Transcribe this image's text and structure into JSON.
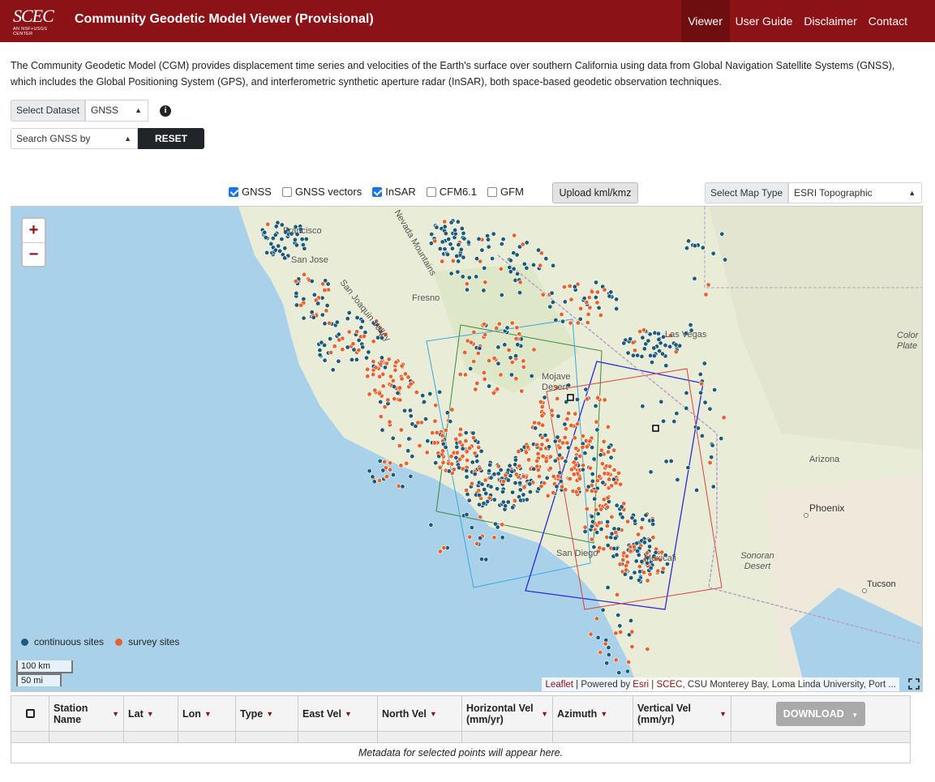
{
  "header": {
    "logo_text": "SCEC",
    "logo_subtext": "AN NSF+USGS CENTER",
    "title": "Community Geodetic Model Viewer (Provisional)",
    "nav": [
      {
        "label": "Viewer",
        "active": true
      },
      {
        "label": "User Guide",
        "active": false
      },
      {
        "label": "Disclaimer",
        "active": false
      },
      {
        "label": "Contact",
        "active": false
      }
    ]
  },
  "intro": "The Community Geodetic Model (CGM) provides displacement time series and velocities of the Earth's surface over southern California using data from Global Navigation Satellite Systems (GNSS), which includes the Global Positioning System (GPS), and interferometric synthetic aperture radar (InSAR), both space-based geodetic observation techniques.",
  "controls": {
    "dataset_label": "Select Dataset",
    "dataset_value": "GNSS",
    "search_value": "Search GNSS by",
    "reset_label": "RESET"
  },
  "layers": [
    {
      "label": "GNSS",
      "checked": true
    },
    {
      "label": "GNSS vectors",
      "checked": false
    },
    {
      "label": "InSAR",
      "checked": true
    },
    {
      "label": "CFM6.1",
      "checked": false
    },
    {
      "label": "GFM",
      "checked": false
    }
  ],
  "upload_label": "Upload kml/kmz",
  "map_type": {
    "label": "Select Map Type",
    "value": "ESRI Topographic"
  },
  "map": {
    "zoom_in": "+",
    "zoom_out": "−",
    "place_labels": [
      "Francisco",
      "San Jose",
      "Fresno",
      "San Joaquin Valley",
      "Nevada Mountains",
      "Las Vegas",
      "Mojave Desert",
      "San Diego",
      "Mexicali",
      "Arizona",
      "Phoenix",
      "Sonoran Desert",
      "Tucson",
      "Color Plate"
    ],
    "legend": [
      {
        "label": "continuous sites",
        "color": "#1d5c78"
      },
      {
        "label": "survey sites",
        "color": "#e8622c"
      }
    ],
    "scale_km": "100 km",
    "scale_mi": "50 mi",
    "attribution": {
      "leaflet": "Leaflet",
      "sep1": " | Powered by ",
      "esri": "Esri",
      "sep2": " | ",
      "scec": "SCEC",
      "rest": ", CSU Monterey Bay, Loma Linda University, Port ..."
    }
  },
  "table": {
    "columns": [
      "Station Name",
      "Lat",
      "Lon",
      "Type",
      "East Vel",
      "North Vel",
      "Horizontal Vel (mm/yr)",
      "Azimuth",
      "Vertical Vel (mm/yr)"
    ],
    "download_label": "DOWNLOAD",
    "empty_message": "Metadata for selected points will appear here."
  }
}
